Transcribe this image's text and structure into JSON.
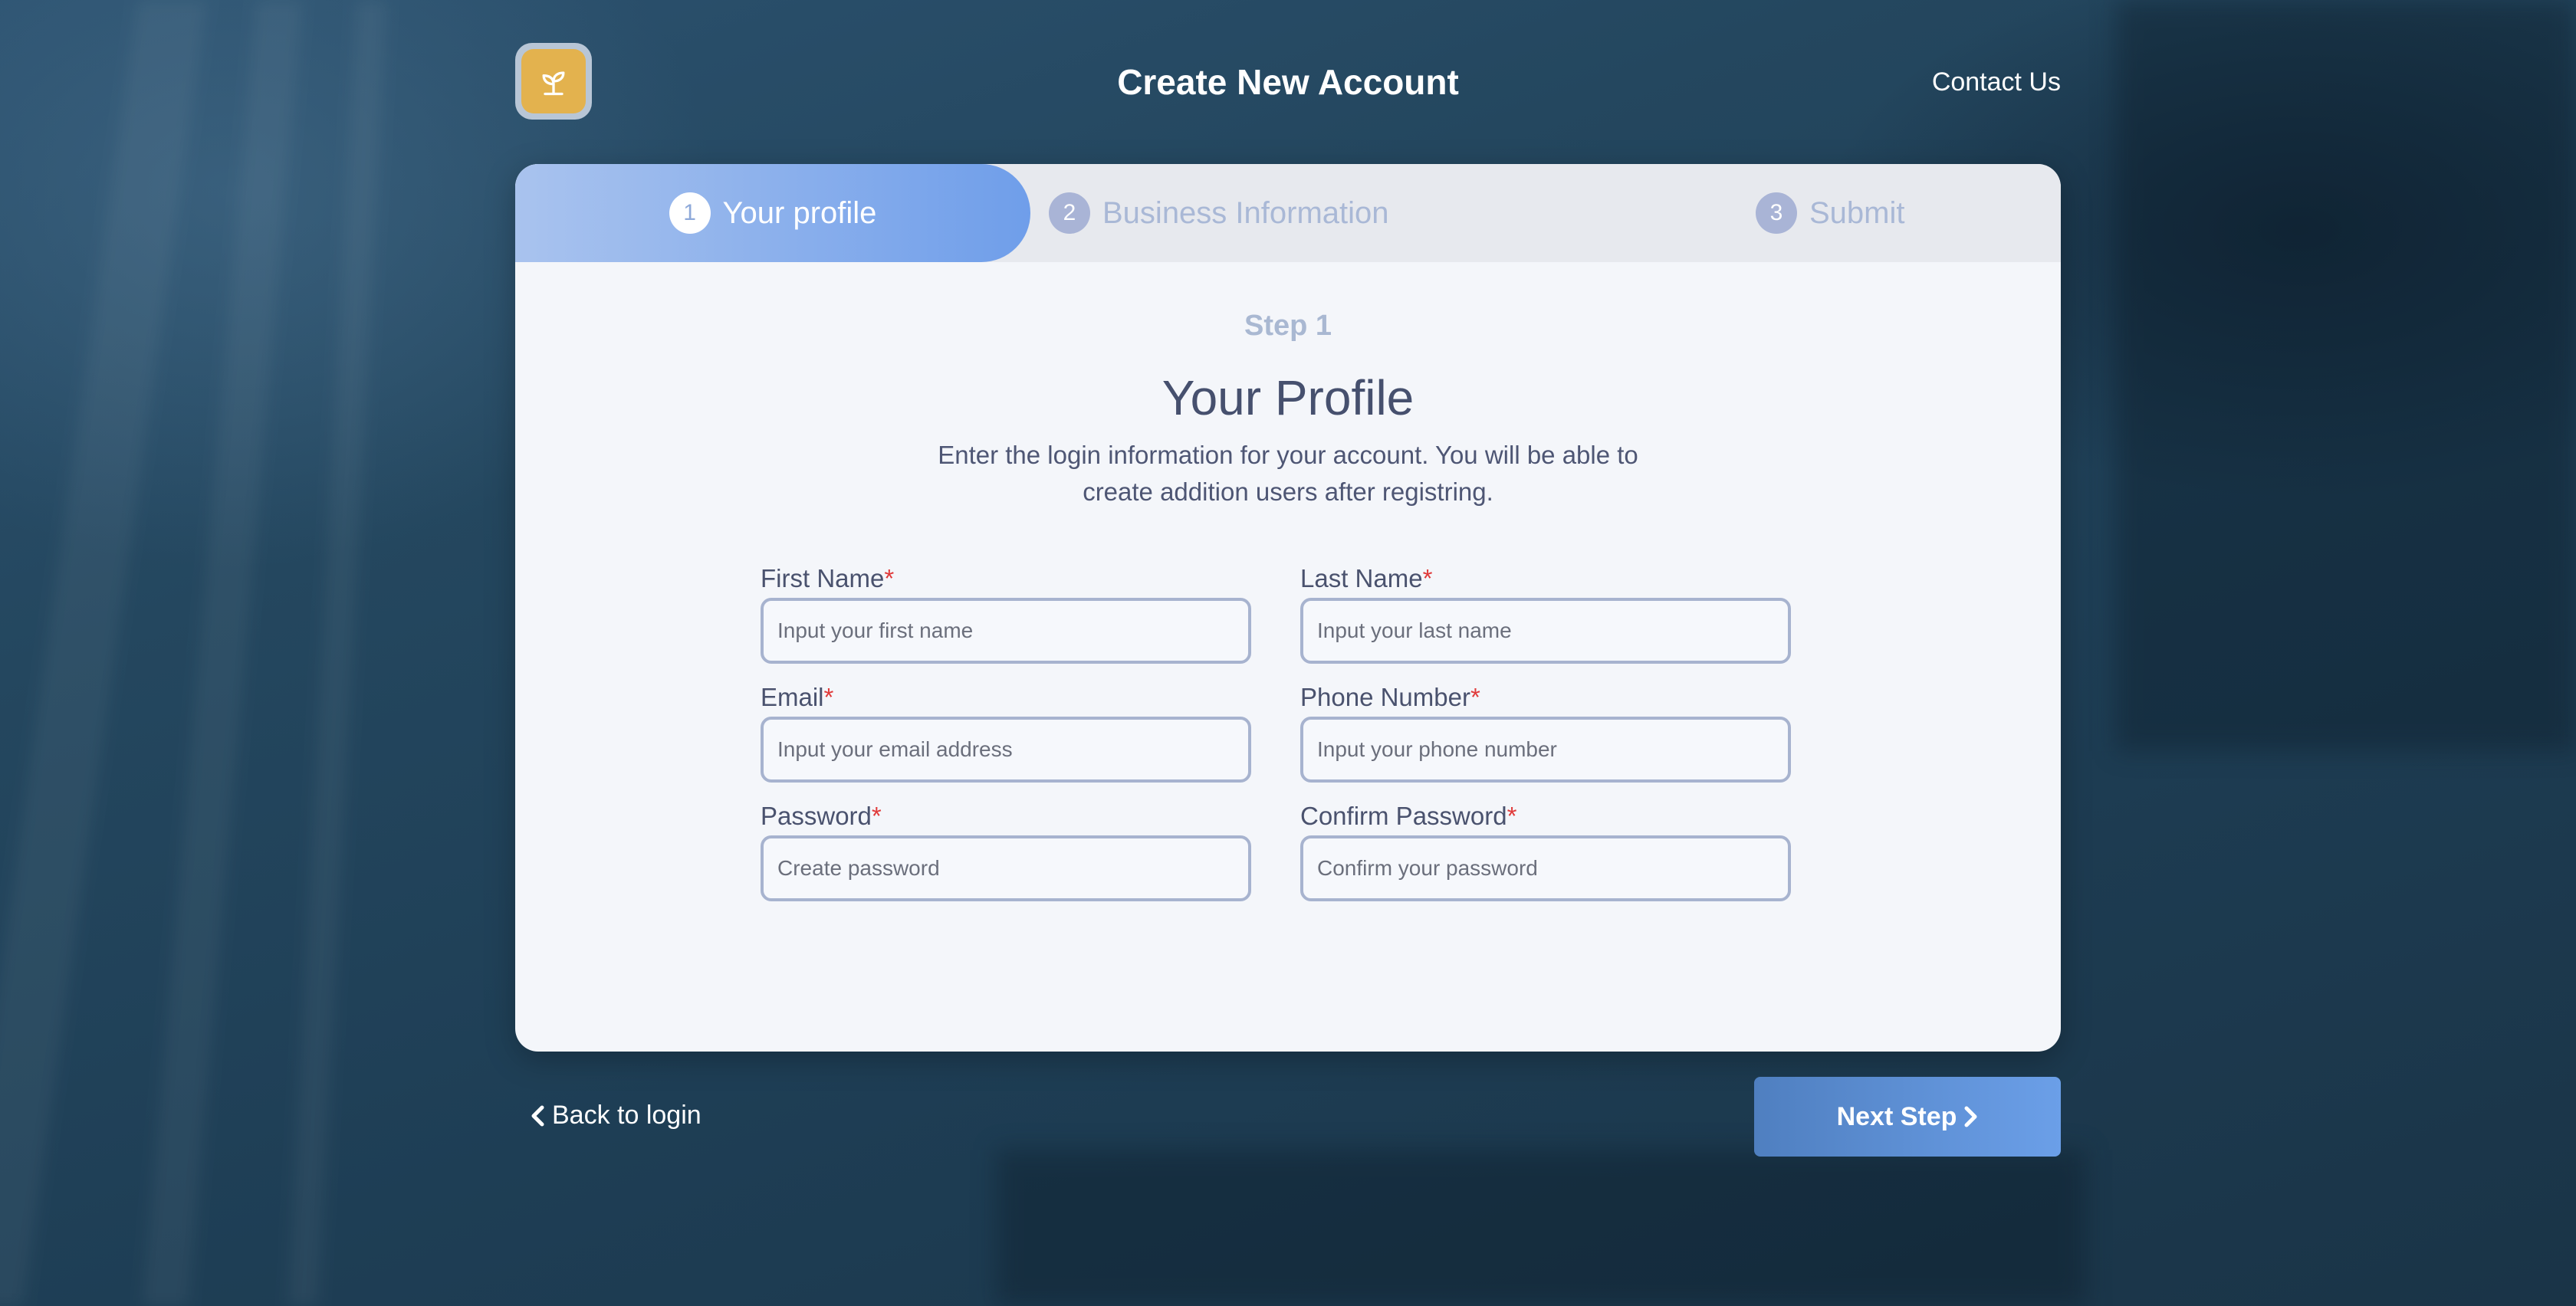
{
  "header": {
    "title": "Create New Account",
    "contact_label": "Contact Us",
    "logo_icon": "sprout-icon",
    "logo_color": "#e3b24e"
  },
  "steps": [
    {
      "number": "1",
      "label": "Your profile",
      "active": true
    },
    {
      "number": "2",
      "label": "Business Information",
      "active": false
    },
    {
      "number": "3",
      "label": "Submit",
      "active": false
    }
  ],
  "form": {
    "step_label": "Step 1",
    "heading": "Your Profile",
    "description": "Enter the login information for your account. You will be able to create addition users after registring.",
    "required_marker": "*",
    "fields": {
      "first_name": {
        "label": "First Name",
        "placeholder": "Input your first name",
        "value": ""
      },
      "last_name": {
        "label": "Last Name",
        "placeholder": "Input your last name",
        "value": ""
      },
      "email": {
        "label": "Email",
        "placeholder": "Input your email address",
        "value": ""
      },
      "phone": {
        "label": "Phone Number",
        "placeholder": "Input your phone number",
        "value": ""
      },
      "password": {
        "label": "Password",
        "placeholder": "Create password",
        "value": ""
      },
      "confirm_password": {
        "label": "Confirm Password",
        "placeholder": "Confirm your password",
        "value": ""
      }
    }
  },
  "footer": {
    "back_label": "Back to login",
    "next_label": "Next Step",
    "accent_color": "#6b9fe8"
  }
}
